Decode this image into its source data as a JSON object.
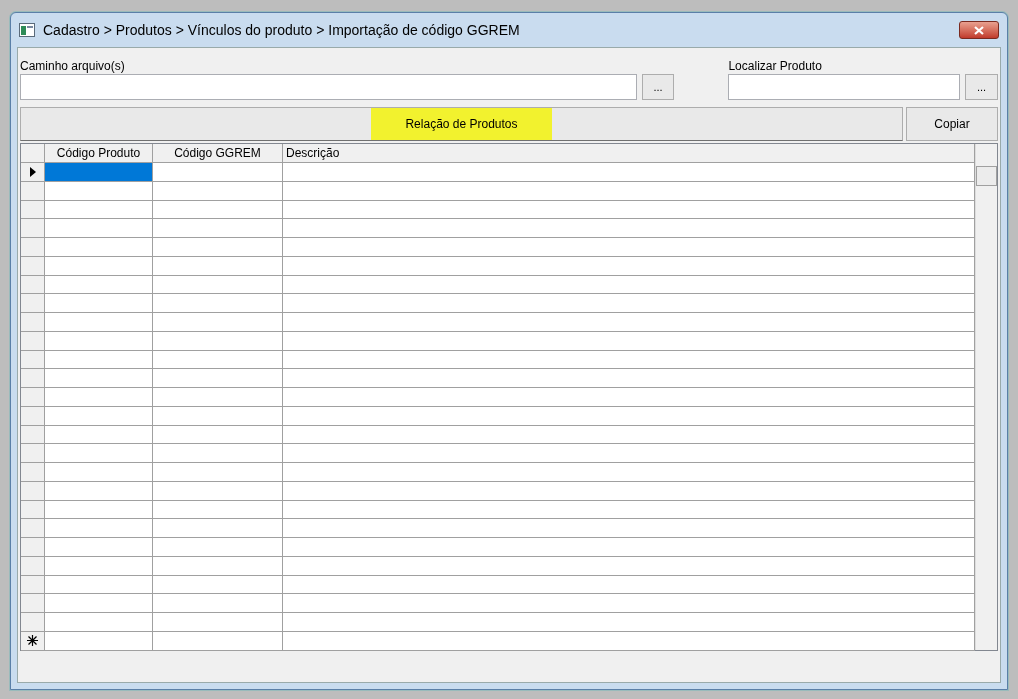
{
  "window": {
    "title": "Cadastro > Produtos > Vínculos do produto > Importação de código GGREM"
  },
  "path_field": {
    "label": "Caminho arquivo(s)",
    "browse": "..."
  },
  "product_field": {
    "label": "Localizar Produto",
    "browse": "..."
  },
  "relation_button": {
    "label": "Relação de Produtos",
    "highlighted": true
  },
  "copy_button": {
    "label": "Copiar"
  },
  "table": {
    "columns": [
      "Código Produto",
      "Código GGREM",
      "Descrição"
    ],
    "rows": [
      {
        "kind": "data",
        "selected": true
      },
      {
        "kind": "data",
        "selected": false
      },
      {
        "kind": "data",
        "selected": false
      },
      {
        "kind": "data",
        "selected": false
      },
      {
        "kind": "data",
        "selected": false
      },
      {
        "kind": "data",
        "selected": false
      },
      {
        "kind": "data",
        "selected": false
      },
      {
        "kind": "data",
        "selected": false
      },
      {
        "kind": "data",
        "selected": false
      },
      {
        "kind": "data",
        "selected": false
      },
      {
        "kind": "data",
        "selected": false
      },
      {
        "kind": "data",
        "selected": false
      },
      {
        "kind": "data",
        "selected": false
      },
      {
        "kind": "data",
        "selected": false
      },
      {
        "kind": "data",
        "selected": false
      },
      {
        "kind": "data",
        "selected": false
      },
      {
        "kind": "data",
        "selected": false
      },
      {
        "kind": "data",
        "selected": false
      },
      {
        "kind": "data",
        "selected": false
      },
      {
        "kind": "data",
        "selected": false
      },
      {
        "kind": "data",
        "selected": false
      },
      {
        "kind": "data",
        "selected": false
      },
      {
        "kind": "data",
        "selected": false
      },
      {
        "kind": "data",
        "selected": false
      },
      {
        "kind": "data",
        "selected": false
      },
      {
        "kind": "new",
        "selected": false
      }
    ]
  }
}
